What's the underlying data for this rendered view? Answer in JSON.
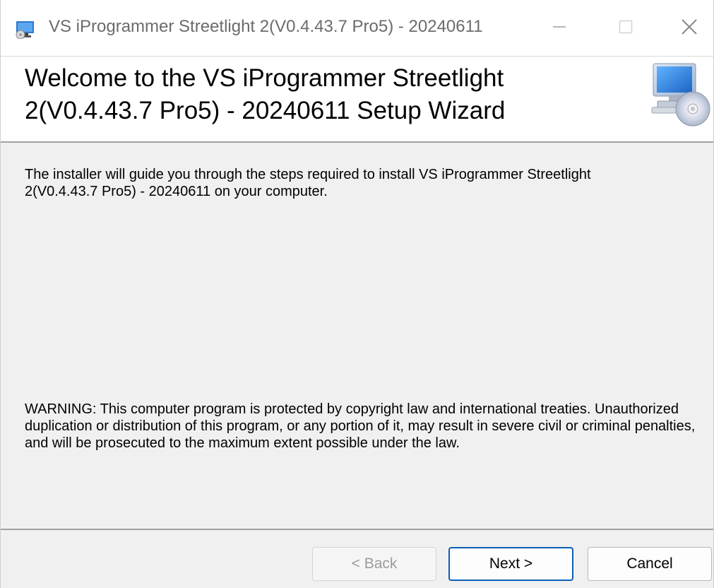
{
  "window": {
    "title": "VS iProgrammer Streetlight 2(V0.4.43.7 Pro5) - 20240611",
    "app_icon": "installer-icon"
  },
  "banner": {
    "title": "Welcome to the VS iProgrammer Streetlight 2(V0.4.43.7 Pro5) - 20240611 Setup Wizard",
    "icon": "computer-cd-icon"
  },
  "body": {
    "intro": "The installer will guide you through the steps required to install VS iProgrammer Streetlight 2(V0.4.43.7 Pro5) - 20240611 on your computer.",
    "warning": "WARNING: This computer program is protected by copyright law and international treaties. Unauthorized duplication or distribution of this program, or any portion of it, may result in severe civil or criminal penalties, and will be prosecuted to the maximum extent possible under the law."
  },
  "buttons": {
    "back": "< Back",
    "next": "Next >",
    "cancel": "Cancel"
  },
  "colors": {
    "window_bg": "#f0f0f0",
    "focus_border": "#0a5fb4"
  }
}
